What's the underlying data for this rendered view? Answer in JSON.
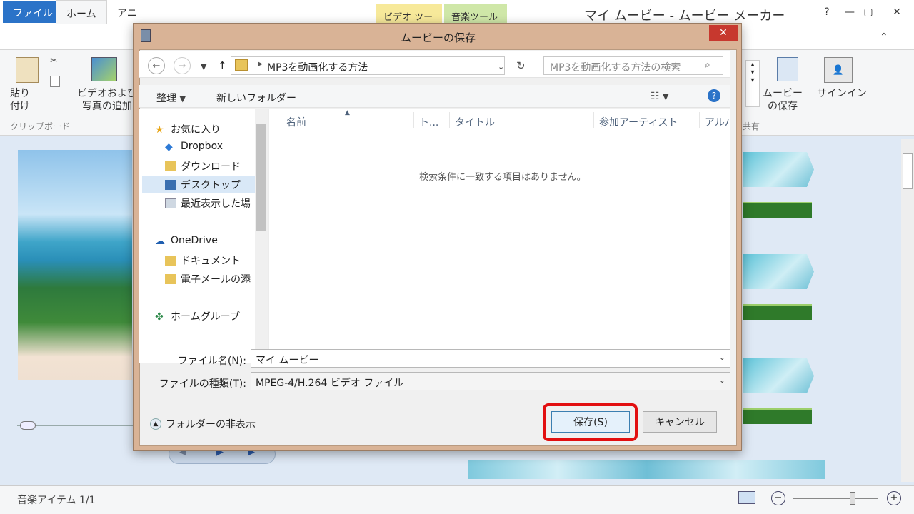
{
  "app": {
    "title": "マイ ムービー - ムービー メーカー",
    "context_tabs": [
      "ビデオ ツール",
      "音楽ツール"
    ],
    "tabs": [
      "ファイル",
      "ホーム",
      "アニ"
    ],
    "ribbon": {
      "paste": "貼り\n付け",
      "clipboard_group": "クリップボード",
      "add_media": "ビデオおよび\n写真の追加",
      "save_movie": "ムービー\nの保存",
      "signin": "サインイン",
      "share_group": "共有"
    },
    "status": "音楽アイテム 1/1"
  },
  "dialog": {
    "title": "ムービーの保存",
    "breadcrumb": "MP3を動画化する方法",
    "search_placeholder": "MP3を動画化する方法の検索",
    "toolbar": {
      "organize": "整理",
      "new_folder": "新しいフォルダー"
    },
    "nav_items": [
      {
        "label": "お気に入り",
        "icon": "star-icon"
      },
      {
        "label": "Dropbox",
        "icon": "dropbox-icon"
      },
      {
        "label": "ダウンロード",
        "icon": "download-folder-icon"
      },
      {
        "label": "デスクトップ",
        "icon": "desktop-icon"
      },
      {
        "label": "最近表示した場",
        "icon": "recent-places-icon"
      },
      {
        "label": "OneDrive",
        "icon": "onedrive-icon"
      },
      {
        "label": "ドキュメント",
        "icon": "folder-icon"
      },
      {
        "label": "電子メールの添",
        "icon": "folder-icon"
      },
      {
        "label": "ホームグループ",
        "icon": "homegroup-icon"
      }
    ],
    "columns": [
      "名前",
      "ト...",
      "タイトル",
      "参加アーティスト",
      "アルバム"
    ],
    "empty_message": "検索条件に一致する項目はありません。",
    "filename_label": "ファイル名(N):",
    "filename_value": "マイ ムービー",
    "filetype_label": "ファイルの種類(T):",
    "filetype_value": "MPEG-4/H.264 ビデオ ファイル",
    "hide_folders": "フォルダーの非表示",
    "save_button": "保存(S)",
    "cancel_button": "キャンセル"
  },
  "colors": {
    "file_tab": "#2b73c8",
    "dialog_frame": "#d9b396",
    "highlight": "#e20f10",
    "close_button": "#c7382e"
  }
}
